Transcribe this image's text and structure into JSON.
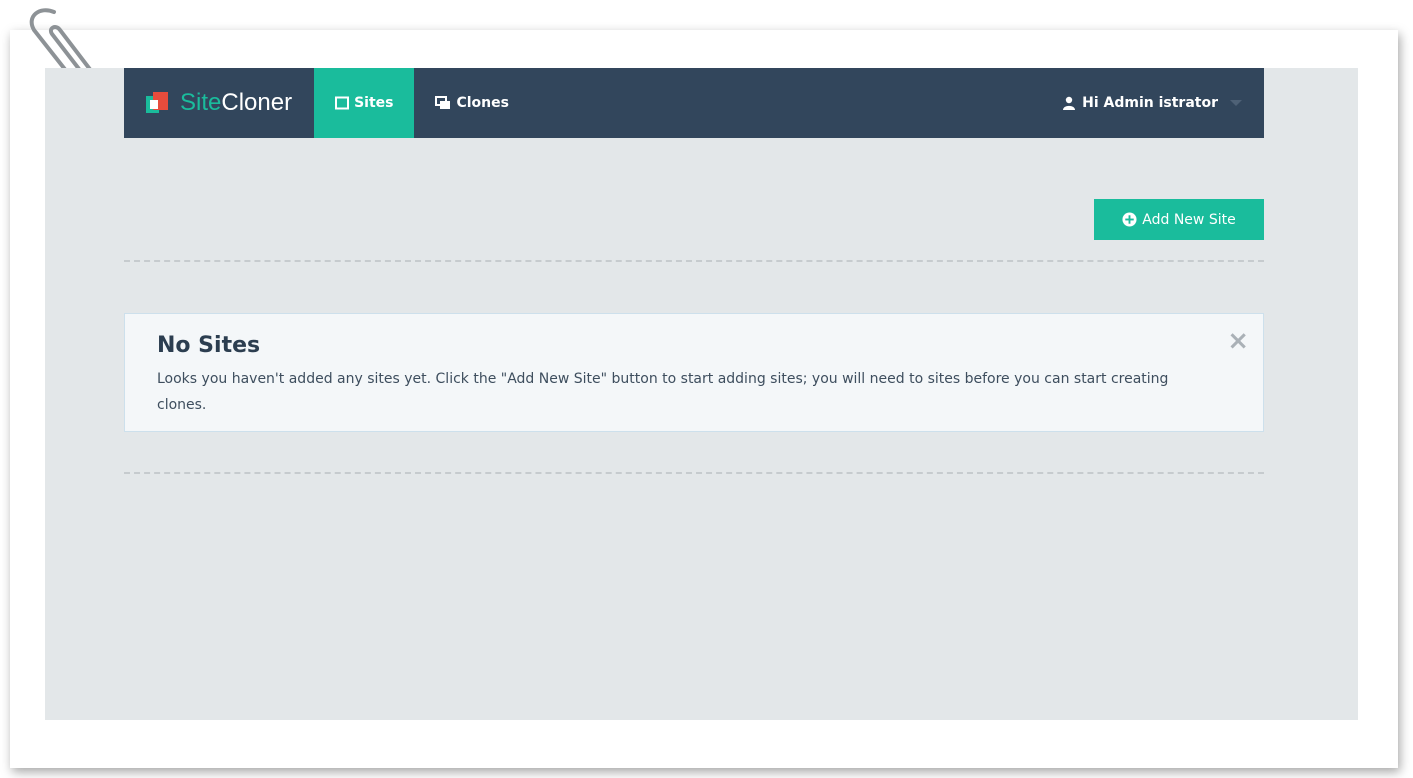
{
  "brand": {
    "name_part1": "Site",
    "name_part2": "Cloner",
    "accent_color": "#1abc9c",
    "navbar_color": "#32465c"
  },
  "nav": {
    "sites_label": "Sites",
    "sites_icon": "square-icon",
    "clones_label": "Clones",
    "clones_icon": "copy-icon"
  },
  "user": {
    "greeting": "Hi Admin istrator",
    "icon": "user-icon"
  },
  "actions": {
    "add_site_label": "Add New Site",
    "add_site_icon": "plus-circle-icon"
  },
  "alert": {
    "title": "No Sites",
    "message": "Looks you haven't added any sites yet. Click the \"Add New Site\" button to start adding sites; you will need to sites before you can start creating clones.",
    "close_label": "×"
  }
}
